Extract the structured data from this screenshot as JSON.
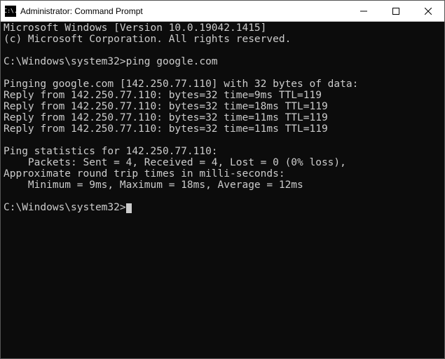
{
  "window": {
    "title": "Administrator: Command Prompt",
    "icon_text": "C:\\."
  },
  "terminal": {
    "lines": [
      "Microsoft Windows [Version 10.0.19042.1415]",
      "(c) Microsoft Corporation. All rights reserved.",
      "",
      "C:\\Windows\\system32>ping google.com",
      "",
      "Pinging google.com [142.250.77.110] with 32 bytes of data:",
      "Reply from 142.250.77.110: bytes=32 time=9ms TTL=119",
      "Reply from 142.250.77.110: bytes=32 time=18ms TTL=119",
      "Reply from 142.250.77.110: bytes=32 time=11ms TTL=119",
      "Reply from 142.250.77.110: bytes=32 time=11ms TTL=119",
      "",
      "Ping statistics for 142.250.77.110:",
      "    Packets: Sent = 4, Received = 4, Lost = 0 (0% loss),",
      "Approximate round trip times in milli-seconds:",
      "    Minimum = 9ms, Maximum = 18ms, Average = 12ms",
      "",
      "C:\\Windows\\system32>"
    ],
    "cursor_on_last_line": true
  }
}
